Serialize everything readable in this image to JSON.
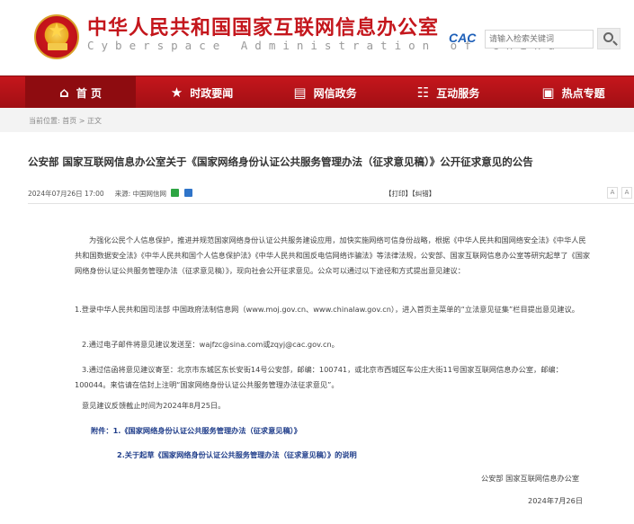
{
  "header": {
    "title": "中华人民共和国国家互联网信息办公室",
    "subtitle": "Cyberspace Administration of China",
    "cac_logo": "CAC",
    "search_placeholder": "请输入检索关键词"
  },
  "nav": {
    "items": [
      {
        "label": "首 页",
        "icon": "home-icon"
      },
      {
        "label": "时政要闻",
        "icon": "star-icon"
      },
      {
        "label": "网信政务",
        "icon": "id-card-icon"
      },
      {
        "label": "互动服务",
        "icon": "chat-icon"
      },
      {
        "label": "热点专题",
        "icon": "folder-icon"
      }
    ]
  },
  "breadcrumb": "当前位置: 首页 > 正文",
  "article": {
    "title": "公安部 国家互联网信息办公室关于《国家网络身份认证公共服务管理办法（征求意见稿）》公开征求意见的公告",
    "date": "2024年07月26日 17:00",
    "source_label": "来源:",
    "source": "中国网信网",
    "print": "【打印】",
    "error": "【纠错】",
    "font_small": "A",
    "font_large": "A",
    "paragraphs": [
      "为强化公民个人信息保护，推进并规范国家网络身份认证公共服务建设应用，加快实施网络可信身份战略，根据《中华人民共和国网络安全法》《中华人民共和国数据安全法》《中华人民共和国个人信息保护法》《中华人民共和国反电信网络诈骗法》等法律法规，公安部、国家互联网信息办公室等研究起草了《国家网络身份认证公共服务管理办法（征求意见稿）》，现向社会公开征求意见。公众可以通过以下途径和方式提出意见建议：",
      "1.登录中华人民共和国司法部 中国政府法制信息网（www.moj.gov.cn、www.chinalaw.gov.cn），进入首页主菜单的“立法意见征集”栏目提出意见建议。",
      "2.通过电子邮件将意见建议发送至：wajfzc@sina.com或zqyj@cac.gov.cn。",
      "3.通过信函将意见建议寄至：北京市东城区东长安街14号公安部，邮编：100741，或北京市西城区车公庄大街11号国家互联网信息办公室，邮编：100044。来信请在信封上注明“国家网络身份认证公共服务管理办法征求意见”。",
      "意见建议反馈截止时间为2024年8月25日。"
    ],
    "attachment1": "附件：1.《国家网络身份认证公共服务管理办法（征求意见稿）》",
    "attachment2": "2.关于起草《国家网络身份认证公共服务管理办法（征求意见稿）》的说明",
    "signature": "公安部 国家互联网信息办公室",
    "sign_date": "2024年7月26日"
  },
  "colors": {
    "brand_red": "#c4161c",
    "nav_red": "#b3121a",
    "link_blue": "#1f3d8a"
  }
}
